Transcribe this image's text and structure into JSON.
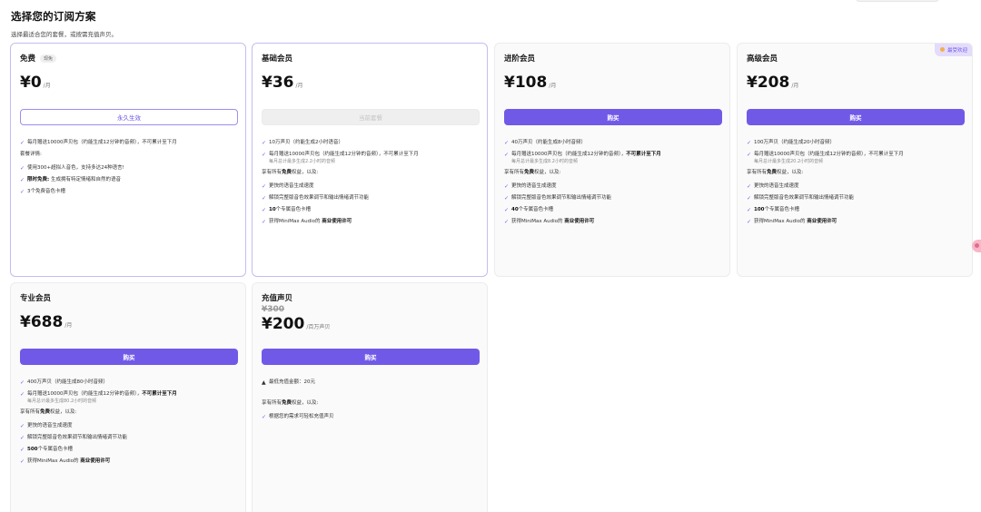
{
  "header": {
    "title": "选择您的订阅方案",
    "subtitle": "选择最适合您的套餐，或按需充值声贝。"
  },
  "plans": [
    {
      "name": "免费",
      "badge": "现免",
      "price": "¥0",
      "unit": "/月",
      "button": "永久生效",
      "f1": "每月赠送10000声贝包（约能生成12分钟的音频），不可累计至下月",
      "detail_title": "套餐详情:",
      "f2": "使用300+超拟人音色，支持多达24种语言!",
      "f3_bold": "限时免费:",
      "f3": " 生成拥有特定情绪和自然的语音",
      "f4": "3个免费音色卡槽"
    },
    {
      "name": "基础会员",
      "price": "¥36",
      "unit": "/月",
      "button": "当前套餐",
      "f1": "10万声贝（约能生成2小时语音）",
      "f2": "每月赠送10000声贝包（约能生成12分钟的音频），不可累计至下月",
      "f2_sub": "每月总计最多生成2.2小时的音频",
      "intro_pre": "享有所有",
      "intro_bold": "免费",
      "intro_post": "权益，以及:",
      "f3": "更快的语音生成速度",
      "f4": "解锁完整版音色效果调节和输出情绪调节功能",
      "f5_bold": "10",
      "f5": "个专属音色卡槽",
      "f6_pre": "获得MiniMax Audio的 ",
      "f6_bold": "商业使用许可"
    },
    {
      "name": "进阶会员",
      "price": "¥108",
      "unit": "/月",
      "button": "购买",
      "f1": "40万声贝（约能生成8小时音频）",
      "f2": "每月赠送10000声贝包（约能生成12分钟的音频），",
      "f2_bold": "不可累计至下月",
      "f2_sub": "每月总计最多生成8.2小时的音频",
      "intro_pre": "享有所有",
      "intro_bold": "免费",
      "intro_post": "权益，以及:",
      "f3": "更快的语音生成速度",
      "f4": "解锁完整版音色效果调节和输出情绪调节功能",
      "f5_bold": "40",
      "f5": "个专属音色卡槽",
      "f6_pre": "获得MiniMax Audio的 ",
      "f6_bold": "商业使用许可"
    },
    {
      "name": "高级会员",
      "tag": "最受欢迎",
      "price": "¥208",
      "unit": "/月",
      "button": "购买",
      "f1": "100万声贝（约能生成20小时音频）",
      "f2": "每月赠送10000声贝包（约能生成12分钟的音频），不可累计至下月",
      "f2_sub": "每月总计最多生成20.2小时的音频",
      "intro_pre": "享有所有",
      "intro_bold": "免费",
      "intro_post": "权益，以及:",
      "f3": "更快的语音生成速度",
      "f4": "解锁完整版音色效果调节和输出情绪调节功能",
      "f5_bold": "100",
      "f5": "个专属音色卡槽",
      "f6_pre": "获得MiniMax Audio的 ",
      "f6_bold": "商业使用许可"
    },
    {
      "name": "专业会员",
      "price": "¥688",
      "unit": "/月",
      "button": "购买",
      "f1": "400万声贝（约能生成80小时音频）",
      "f2": "每月赠送10000声贝包（约能生成12分钟的音频），",
      "f2_bold": "不可累计至下月",
      "f2_sub": "每月总计最多生成80.2小时的音频",
      "intro_pre": "享有所有",
      "intro_bold": "免费",
      "intro_post": "权益，以及:",
      "f3": "更快的语音生成速度",
      "f4": "解锁完整版音色效果调节和输出情绪调节功能",
      "f5_bold": "500",
      "f5": "个专属音色卡槽",
      "f6_pre": "获得MiniMax Audio的 ",
      "f6_bold": "商业使用许可"
    }
  ],
  "topup": {
    "name": "充值声贝",
    "old_price": "¥300",
    "price": "¥200",
    "unit": "/百万声贝",
    "button": "购买",
    "min_note": "最低充值金额：20元",
    "intro_pre": "享有所有",
    "intro_bold": "免费",
    "intro_post": "权益，以及:",
    "f1": "根据您的需求可轻松充值声贝"
  },
  "icons": {
    "check": "check-icon",
    "warning": "warning-icon",
    "popular": "star-icon"
  },
  "colors": {
    "accent": "#7159e8",
    "accent_light": "#e4dcfb",
    "featured_border": "#c6bcf2"
  }
}
